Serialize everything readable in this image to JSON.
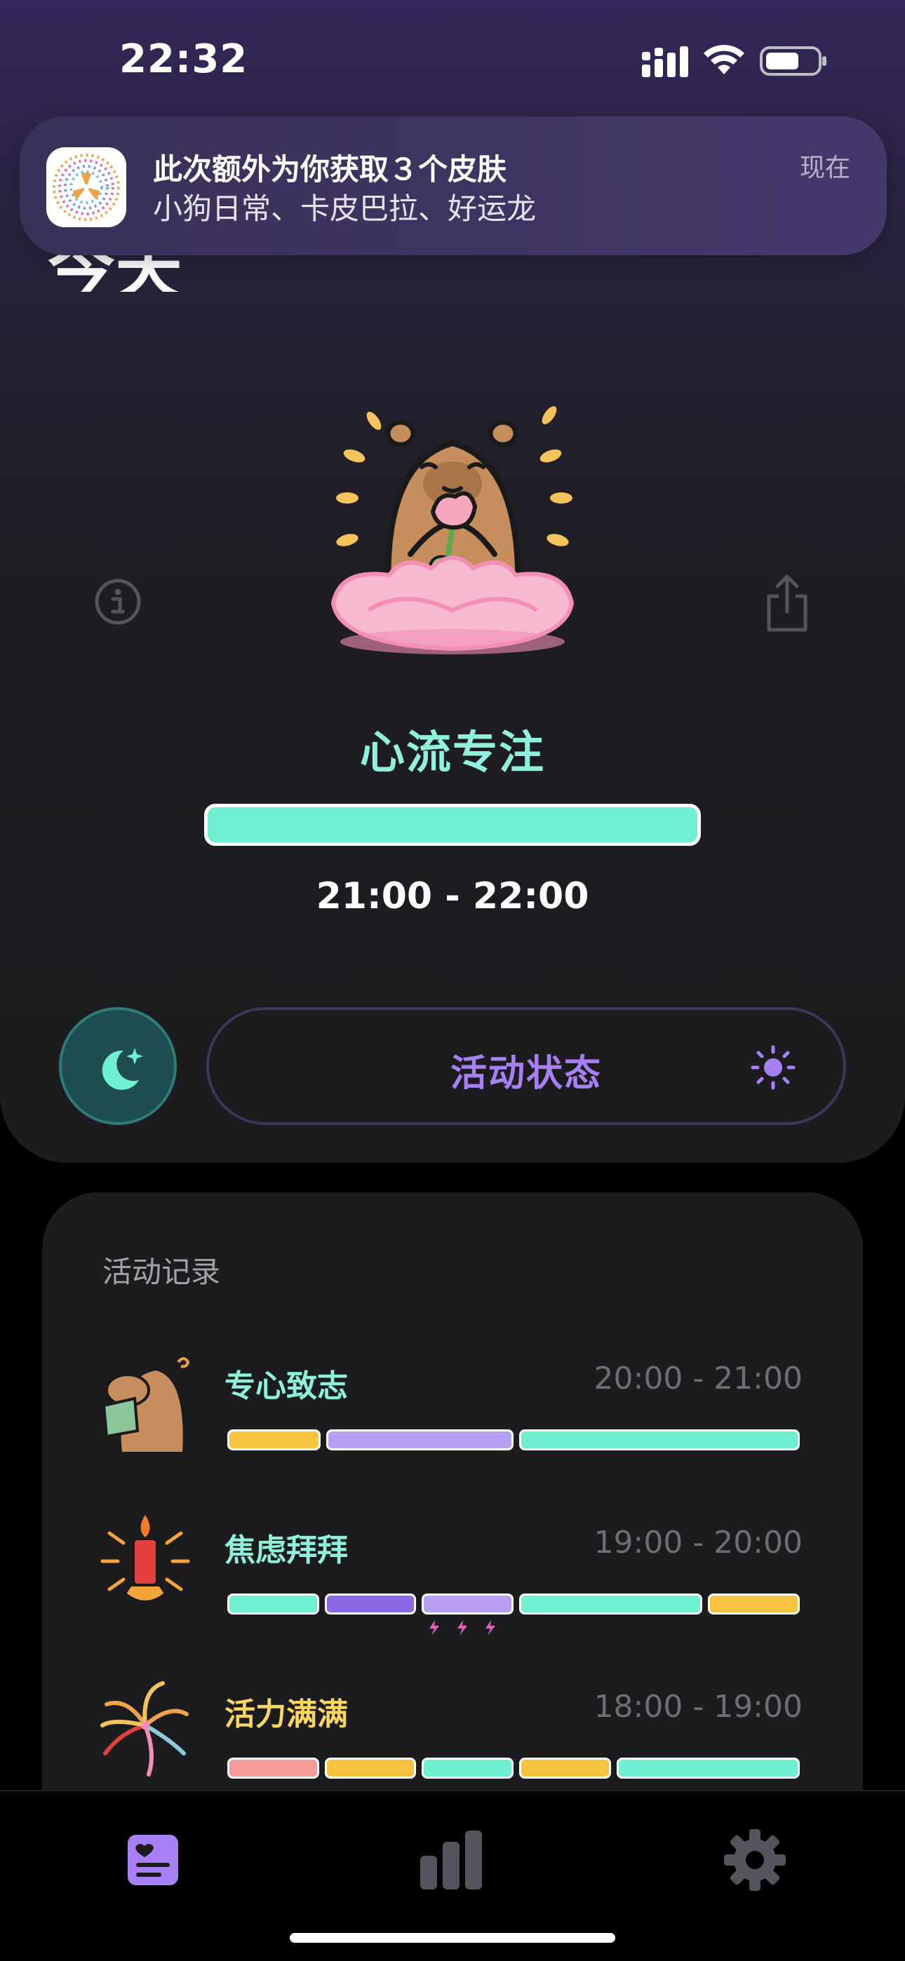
{
  "status_bar": {
    "time": "22:32"
  },
  "notification": {
    "title": "此次额外为你获取３个皮肤",
    "body": "小狗日常、卡皮巴拉、好运龙",
    "time": "现在"
  },
  "header": {
    "title_partial": "今天"
  },
  "current_state": {
    "name": "心流专注",
    "time_range": "21:00 - 22:00",
    "bar_color": "#6ff0d3"
  },
  "controls": {
    "activity_label": "活动状态",
    "accent_color": "#a780f5"
  },
  "activity_log": {
    "heading": "活动记录",
    "items": [
      {
        "name": "专心致志",
        "name_color": "#8ff0dc",
        "time": "20:00 - 21:00",
        "segments": [
          {
            "color": "#f7c442",
            "weight": 1
          },
          {
            "color": "#b79ff5",
            "weight": 2
          },
          {
            "color": "#6ff0d3",
            "weight": 3
          }
        ]
      },
      {
        "name": "焦虑拜拜",
        "name_color": "#8ff0dc",
        "time": "19:00 - 20:00",
        "segments": [
          {
            "color": "#6ff0d3",
            "weight": 1
          },
          {
            "color": "#8a68e6",
            "weight": 1
          },
          {
            "color": "#b79ff5",
            "weight": 1
          },
          {
            "color": "#6ff0d3",
            "weight": 2
          },
          {
            "color": "#f7c442",
            "weight": 1
          }
        ]
      },
      {
        "name": "活力满满",
        "name_color": "#f9d65e",
        "time": "18:00 - 19:00",
        "segments": [
          {
            "color": "#f79a9a",
            "weight": 1
          },
          {
            "color": "#f7c442",
            "weight": 1
          },
          {
            "color": "#6ff0d3",
            "weight": 1
          },
          {
            "color": "#f7c442",
            "weight": 1
          },
          {
            "color": "#6ff0d3",
            "weight": 2
          }
        ]
      }
    ]
  },
  "tabs": [
    {
      "icon": "journal-icon",
      "active": true
    },
    {
      "icon": "stats-icon",
      "active": false
    },
    {
      "icon": "settings-icon",
      "active": false
    }
  ]
}
